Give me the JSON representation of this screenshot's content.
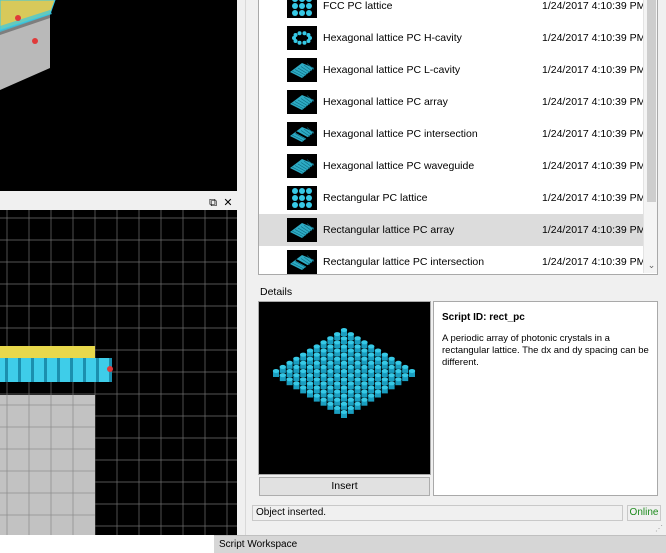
{
  "view2d": {
    "float_icon": "⧉",
    "close_icon": "✕"
  },
  "scripts": [
    {
      "name": "FCC PC lattice",
      "date": "1/24/2017 4:10:39 PM",
      "icon": "fcc-lattice-icon"
    },
    {
      "name": "Hexagonal lattice PC H-cavity",
      "date": "1/24/2017 4:10:39 PM",
      "icon": "hex-h-cavity-icon"
    },
    {
      "name": "Hexagonal lattice PC L-cavity",
      "date": "1/24/2017 4:10:39 PM",
      "icon": "hex-l-cavity-icon"
    },
    {
      "name": "Hexagonal lattice PC array",
      "date": "1/24/2017 4:10:39 PM",
      "icon": "hex-array-icon"
    },
    {
      "name": "Hexagonal lattice PC intersection",
      "date": "1/24/2017 4:10:39 PM",
      "icon": "hex-intersection-icon"
    },
    {
      "name": "Hexagonal lattice PC waveguide",
      "date": "1/24/2017 4:10:39 PM",
      "icon": "hex-waveguide-icon"
    },
    {
      "name": "Rectangular PC lattice",
      "date": "1/24/2017 4:10:39 PM",
      "icon": "rect-lattice-icon"
    },
    {
      "name": "Rectangular lattice PC array",
      "date": "1/24/2017 4:10:39 PM",
      "icon": "rect-array-icon",
      "selected": true
    },
    {
      "name": "Rectangular lattice PC intersection",
      "date": "1/24/2017 4:10:39 PM",
      "icon": "rect-intersection-icon"
    }
  ],
  "list": {
    "scroll_down_icon": "⌄"
  },
  "details": {
    "label": "Details",
    "script_id": "Script ID: rect_pc",
    "description": "A periodic array of photonic crystals in a rectangular lattice. The dx and dy spacing can be different.",
    "insert_label": "Insert"
  },
  "status": {
    "message": "Object inserted.",
    "online": "Online",
    "online_color": "#1d8b1d"
  },
  "workspace": {
    "tab_label": "Script Workspace"
  },
  "colors": {
    "accent_cyan": "#36c9e6",
    "selected_row": "#dcdcdc"
  }
}
